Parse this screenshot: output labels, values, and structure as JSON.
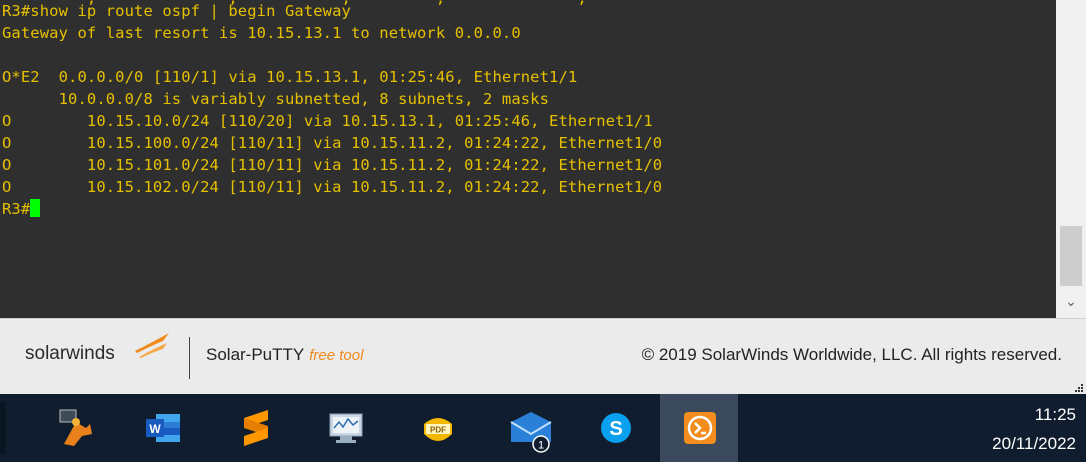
{
  "terminal": {
    "partial_line": "         ,              ,           ,         ,              ,     ",
    "lines": [
      "R3#show ip route ospf | begin Gateway",
      "Gateway of last resort is 10.15.13.1 to network 0.0.0.0",
      "",
      "O*E2  0.0.0.0/0 [110/1] via 10.15.13.1, 01:25:46, Ethernet1/1",
      "      10.0.0.0/8 is variably subnetted, 8 subnets, 2 masks",
      "O        10.15.10.0/24 [110/20] via 10.15.13.1, 01:25:46, Ethernet1/1",
      "O        10.15.100.0/24 [110/11] via 10.15.11.2, 01:24:22, Ethernet1/0",
      "O        10.15.101.0/24 [110/11] via 10.15.11.2, 01:24:22, Ethernet1/0",
      "O        10.15.102.0/24 [110/11] via 10.15.11.2, 01:24:22, Ethernet1/0"
    ],
    "prompt": "R3#",
    "text_color": "#e6c000",
    "cursor_color": "#00ff00",
    "background": "#2f2f2f"
  },
  "scrollbar": {
    "down_arrow": "⌄"
  },
  "banner": {
    "brand": "solarwinds",
    "product": "Solar-PuTTY",
    "product_tag": "free tool",
    "copyright": "© 2019 SolarWinds Worldwide, LLC. All rights reserved.",
    "accent": "#f08a1c"
  },
  "taskbar": {
    "apps": [
      {
        "name": "gns3-icon"
      },
      {
        "name": "word-icon",
        "label": "W"
      },
      {
        "name": "sublime-text-icon"
      },
      {
        "name": "network-monitor-icon"
      },
      {
        "name": "pdf-icon",
        "label": "PDF"
      },
      {
        "name": "mail-icon",
        "badge": "1"
      },
      {
        "name": "skype-icon",
        "label": "S"
      },
      {
        "name": "solar-putty-icon"
      }
    ],
    "time": "11:25",
    "date": "20/11/2022",
    "background": "#0f1d2e"
  }
}
